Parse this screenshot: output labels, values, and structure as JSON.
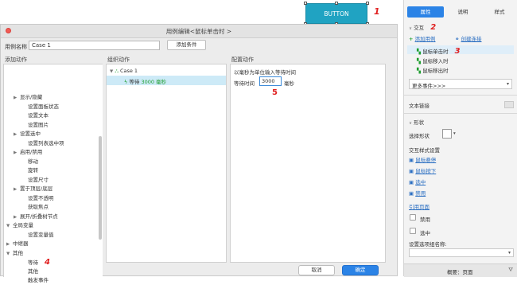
{
  "canvas": {
    "widget_label": "BUTTON",
    "annotation_1": "1"
  },
  "dialog": {
    "title": "用例编辑<鼠标单击时 >",
    "case_name_label": "用例名称",
    "case_name_value": "Case 1",
    "add_condition_label": "添加条件",
    "col_add_action": "添加动作",
    "col_organize_action": "组织动作",
    "col_configure_action": "配置动作",
    "action_tree": [
      {
        "label": "显示/隐藏",
        "indent": 1,
        "arrow": "▶"
      },
      {
        "label": "设置面板状态",
        "indent": 2,
        "arrow": ""
      },
      {
        "label": "设置文本",
        "indent": 2,
        "arrow": ""
      },
      {
        "label": "设置图片",
        "indent": 2,
        "arrow": ""
      },
      {
        "label": "设置选中",
        "indent": 1,
        "arrow": "▶"
      },
      {
        "label": "设置列表选中项",
        "indent": 2,
        "arrow": ""
      },
      {
        "label": "启用/禁用",
        "indent": 1,
        "arrow": "▶"
      },
      {
        "label": "移动",
        "indent": 2,
        "arrow": ""
      },
      {
        "label": "旋转",
        "indent": 2,
        "arrow": ""
      },
      {
        "label": "设置尺寸",
        "indent": 2,
        "arrow": ""
      },
      {
        "label": "置于顶层/底层",
        "indent": 1,
        "arrow": "▶"
      },
      {
        "label": "设置不透明",
        "indent": 2,
        "arrow": ""
      },
      {
        "label": "获取焦点",
        "indent": 2,
        "arrow": ""
      },
      {
        "label": "展开/折叠树节点",
        "indent": 1,
        "arrow": "▶"
      },
      {
        "label": "全局变量",
        "indent": 0,
        "arrow": "▼"
      },
      {
        "label": "设置变量值",
        "indent": 2,
        "arrow": ""
      },
      {
        "label": "中继器",
        "indent": 0,
        "arrow": "▶"
      },
      {
        "label": "其他",
        "indent": 0,
        "arrow": "▼"
      },
      {
        "label": "等待",
        "indent": 2,
        "arrow": ""
      },
      {
        "label": "其他",
        "indent": 2,
        "arrow": ""
      },
      {
        "label": "触发事件",
        "indent": 2,
        "arrow": ""
      }
    ],
    "annotation_4": "4",
    "organize": {
      "case_label": "Case 1",
      "wait_label": "等待",
      "wait_value": "3000 毫秒"
    },
    "configure": {
      "description": "以毫秒为单位输入等待时间",
      "wait_time_label": "等待时间",
      "wait_time_value": "3000",
      "unit": "毫秒",
      "annotation_5": "5"
    },
    "cancel_label": "取消",
    "ok_label": "确定"
  },
  "sidebar": {
    "tabs": [
      "属性",
      "说明",
      "样式"
    ],
    "interaction_header": "交互",
    "annotation_2": "2",
    "add_case_label": "添加用例",
    "create_link_label": "创建连接",
    "events": [
      "鼠标单击时",
      "鼠标移入时",
      "鼠标移出时"
    ],
    "annotation_3": "3",
    "more_events_label": "更多事件>>>",
    "text_link_label": "文本链接",
    "shape_header": "形状",
    "select_shape_label": "选择形状",
    "interaction_style_label": "交互样式设置",
    "style_links": [
      "鼠标悬停",
      "鼠标按下",
      "选中",
      "禁用"
    ],
    "reference_page_label": "引用页面",
    "disabled_label": "禁用",
    "selected_label": "选中",
    "option_group_label": "设置选项组名称:",
    "bottom_label": "概要：页面",
    "colors": {
      "accent": "#2b83e6",
      "annotation": "#e02020",
      "widget": "#20a3c2"
    }
  }
}
